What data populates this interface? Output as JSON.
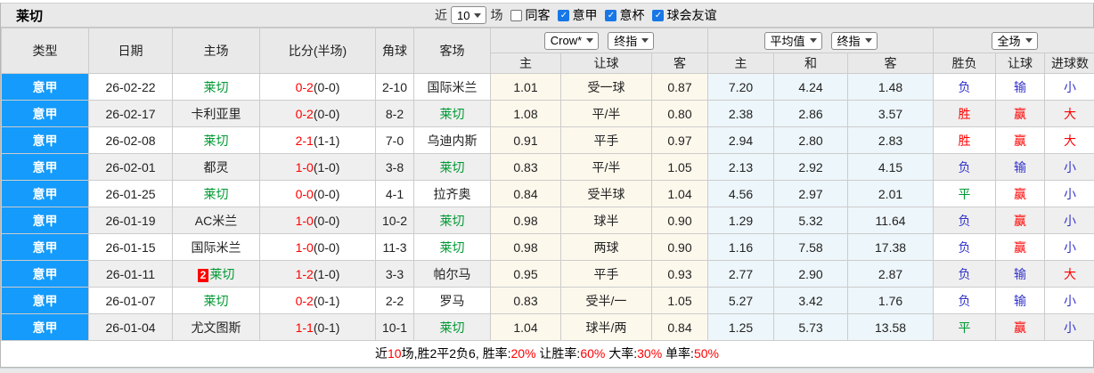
{
  "title": "莱切",
  "toolbar": {
    "near_label": "近",
    "matches_select": "10",
    "matches_suffix": "场",
    "filters": [
      {
        "label": "同客",
        "checked": false
      },
      {
        "label": "意甲",
        "checked": true
      },
      {
        "label": "意杯",
        "checked": true
      },
      {
        "label": "球会友谊",
        "checked": true
      }
    ]
  },
  "header": {
    "type": "类型",
    "date": "日期",
    "home": "主场",
    "score": "比分(半场)",
    "corner": "角球",
    "away": "客场",
    "bookmaker_select": "Crow*",
    "bookmaker_final_select": "终指",
    "avg_select": "平均值",
    "avg_final_select": "终指",
    "scope_select": "全场",
    "asian_home": "主",
    "asian_line": "让球",
    "asian_away": "客",
    "euro_home": "主",
    "euro_draw": "和",
    "euro_away": "客",
    "result_wdl": "胜负",
    "result_handicap": "让球",
    "result_goals": "进球数"
  },
  "rows": [
    {
      "league": "意甲",
      "date": "26-02-22",
      "home": "莱切",
      "home_is_subject": true,
      "home_badge": "",
      "score_ft": "0-2",
      "score_ht": "(0-0)",
      "corner": "2-10",
      "away": "国际米兰",
      "away_is_subject": false,
      "asian_home": "1.01",
      "asian_line": "受一球",
      "asian_away": "0.87",
      "euro_home": "7.20",
      "euro_draw": "4.24",
      "euro_away": "1.48",
      "wdl": "负",
      "wdl_color": "blue",
      "handicap": "输",
      "handicap_color": "blue",
      "goals": "小",
      "goals_color": "blue"
    },
    {
      "league": "意甲",
      "date": "26-02-17",
      "home": "卡利亚里",
      "home_is_subject": false,
      "home_badge": "",
      "score_ft": "0-2",
      "score_ht": "(0-0)",
      "corner": "8-2",
      "away": "莱切",
      "away_is_subject": true,
      "asian_home": "1.08",
      "asian_line": "平/半",
      "asian_away": "0.80",
      "euro_home": "2.38",
      "euro_draw": "2.86",
      "euro_away": "3.57",
      "wdl": "胜",
      "wdl_color": "red",
      "handicap": "赢",
      "handicap_color": "red",
      "goals": "大",
      "goals_color": "red"
    },
    {
      "league": "意甲",
      "date": "26-02-08",
      "home": "莱切",
      "home_is_subject": true,
      "home_badge": "",
      "score_ft": "2-1",
      "score_ht": "(1-1)",
      "corner": "7-0",
      "away": "乌迪内斯",
      "away_is_subject": false,
      "asian_home": "0.91",
      "asian_line": "平手",
      "asian_away": "0.97",
      "euro_home": "2.94",
      "euro_draw": "2.80",
      "euro_away": "2.83",
      "wdl": "胜",
      "wdl_color": "red",
      "handicap": "赢",
      "handicap_color": "red",
      "goals": "大",
      "goals_color": "red"
    },
    {
      "league": "意甲",
      "date": "26-02-01",
      "home": "都灵",
      "home_is_subject": false,
      "home_badge": "",
      "score_ft": "1-0",
      "score_ht": "(1-0)",
      "corner": "3-8",
      "away": "莱切",
      "away_is_subject": true,
      "asian_home": "0.83",
      "asian_line": "平/半",
      "asian_away": "1.05",
      "euro_home": "2.13",
      "euro_draw": "2.92",
      "euro_away": "4.15",
      "wdl": "负",
      "wdl_color": "blue",
      "handicap": "输",
      "handicap_color": "blue",
      "goals": "小",
      "goals_color": "blue"
    },
    {
      "league": "意甲",
      "date": "26-01-25",
      "home": "莱切",
      "home_is_subject": true,
      "home_badge": "",
      "score_ft": "0-0",
      "score_ht": "(0-0)",
      "corner": "4-1",
      "away": "拉齐奥",
      "away_is_subject": false,
      "asian_home": "0.84",
      "asian_line": "受半球",
      "asian_away": "1.04",
      "euro_home": "4.56",
      "euro_draw": "2.97",
      "euro_away": "2.01",
      "wdl": "平",
      "wdl_color": "green",
      "handicap": "赢",
      "handicap_color": "red",
      "goals": "小",
      "goals_color": "blue"
    },
    {
      "league": "意甲",
      "date": "26-01-19",
      "home": "AC米兰",
      "home_is_subject": false,
      "home_badge": "",
      "score_ft": "1-0",
      "score_ht": "(0-0)",
      "corner": "10-2",
      "away": "莱切",
      "away_is_subject": true,
      "asian_home": "0.98",
      "asian_line": "球半",
      "asian_away": "0.90",
      "euro_home": "1.29",
      "euro_draw": "5.32",
      "euro_away": "11.64",
      "wdl": "负",
      "wdl_color": "blue",
      "handicap": "赢",
      "handicap_color": "red",
      "goals": "小",
      "goals_color": "blue"
    },
    {
      "league": "意甲",
      "date": "26-01-15",
      "home": "国际米兰",
      "home_is_subject": false,
      "home_badge": "",
      "score_ft": "1-0",
      "score_ht": "(0-0)",
      "corner": "11-3",
      "away": "莱切",
      "away_is_subject": true,
      "asian_home": "0.98",
      "asian_line": "两球",
      "asian_away": "0.90",
      "euro_home": "1.16",
      "euro_draw": "7.58",
      "euro_away": "17.38",
      "wdl": "负",
      "wdl_color": "blue",
      "handicap": "赢",
      "handicap_color": "red",
      "goals": "小",
      "goals_color": "blue"
    },
    {
      "league": "意甲",
      "date": "26-01-11",
      "home": "莱切",
      "home_is_subject": true,
      "home_badge": "2",
      "score_ft": "1-2",
      "score_ht": "(1-0)",
      "corner": "3-3",
      "away": "帕尔马",
      "away_is_subject": false,
      "asian_home": "0.95",
      "asian_line": "平手",
      "asian_away": "0.93",
      "euro_home": "2.77",
      "euro_draw": "2.90",
      "euro_away": "2.87",
      "wdl": "负",
      "wdl_color": "blue",
      "handicap": "输",
      "handicap_color": "blue",
      "goals": "大",
      "goals_color": "red"
    },
    {
      "league": "意甲",
      "date": "26-01-07",
      "home": "莱切",
      "home_is_subject": true,
      "home_badge": "",
      "score_ft": "0-2",
      "score_ht": "(0-1)",
      "corner": "2-2",
      "away": "罗马",
      "away_is_subject": false,
      "asian_home": "0.83",
      "asian_line": "受半/一",
      "asian_away": "1.05",
      "euro_home": "5.27",
      "euro_draw": "3.42",
      "euro_away": "1.76",
      "wdl": "负",
      "wdl_color": "blue",
      "handicap": "输",
      "handicap_color": "blue",
      "goals": "小",
      "goals_color": "blue"
    },
    {
      "league": "意甲",
      "date": "26-01-04",
      "home": "尤文图斯",
      "home_is_subject": false,
      "home_badge": "",
      "score_ft": "1-1",
      "score_ht": "(0-1)",
      "corner": "10-1",
      "away": "莱切",
      "away_is_subject": true,
      "asian_home": "1.04",
      "asian_line": "球半/两",
      "asian_away": "0.84",
      "euro_home": "1.25",
      "euro_draw": "5.73",
      "euro_away": "13.58",
      "wdl": "平",
      "wdl_color": "green",
      "handicap": "赢",
      "handicap_color": "red",
      "goals": "小",
      "goals_color": "blue"
    }
  ],
  "summary": {
    "segments": [
      {
        "text": "近",
        "red": false
      },
      {
        "text": "10",
        "red": true
      },
      {
        "text": "场,胜2平2负6, 胜率:",
        "red": false
      },
      {
        "text": "20%",
        "red": true
      },
      {
        "text": " 让胜率:",
        "red": false
      },
      {
        "text": "60%",
        "red": true
      },
      {
        "text": " 大率:",
        "red": false
      },
      {
        "text": "30%",
        "red": true
      },
      {
        "text": " 单率:",
        "red": false
      },
      {
        "text": "50%",
        "red": true
      }
    ]
  },
  "colors": {
    "league-blue": "#149bfb",
    "subject-green": "#009933",
    "score-red": "#ff0000",
    "outcome-red": "#ff0000",
    "outcome-blue": "#3333cc",
    "outcome-green": "#009933",
    "asian-bg": "#fdf8ec",
    "euro-bg": "#edf6fa",
    "row-alt-bg": "#efefef",
    "header-bg": "#e9e9e9",
    "checkbox-blue": "#1877e6",
    "summary-red": "#ff0000"
  }
}
